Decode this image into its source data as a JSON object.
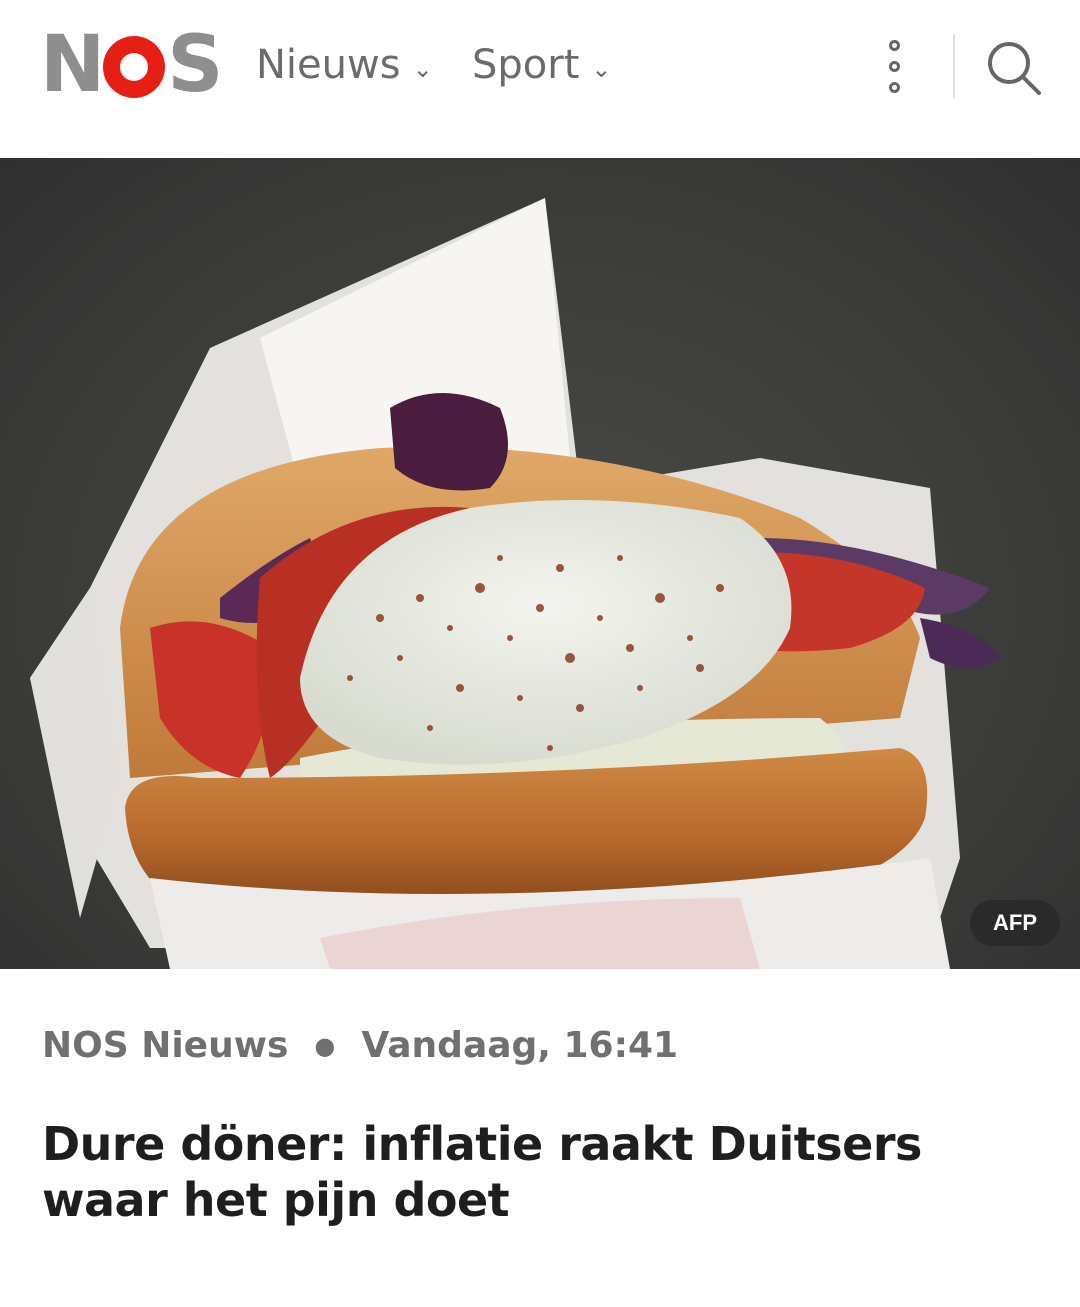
{
  "header": {
    "logo_text": {
      "n": "N",
      "s": "S"
    },
    "nav": [
      {
        "label": "Nieuws",
        "icon": "chevron-down-icon"
      },
      {
        "label": "Sport",
        "icon": "chevron-down-icon"
      }
    ],
    "more_icon": "more-vertical-icon",
    "search_icon": "search-icon"
  },
  "article": {
    "image_credit": "AFP",
    "source": "NOS Nieuws",
    "timestamp": "Vandaag, 16:41",
    "title": "Dure döner: inflatie raakt Duitsers waar het pijn doet"
  },
  "colors": {
    "brand_red": "#e61e14",
    "logo_gray": "#8e8e8e"
  }
}
